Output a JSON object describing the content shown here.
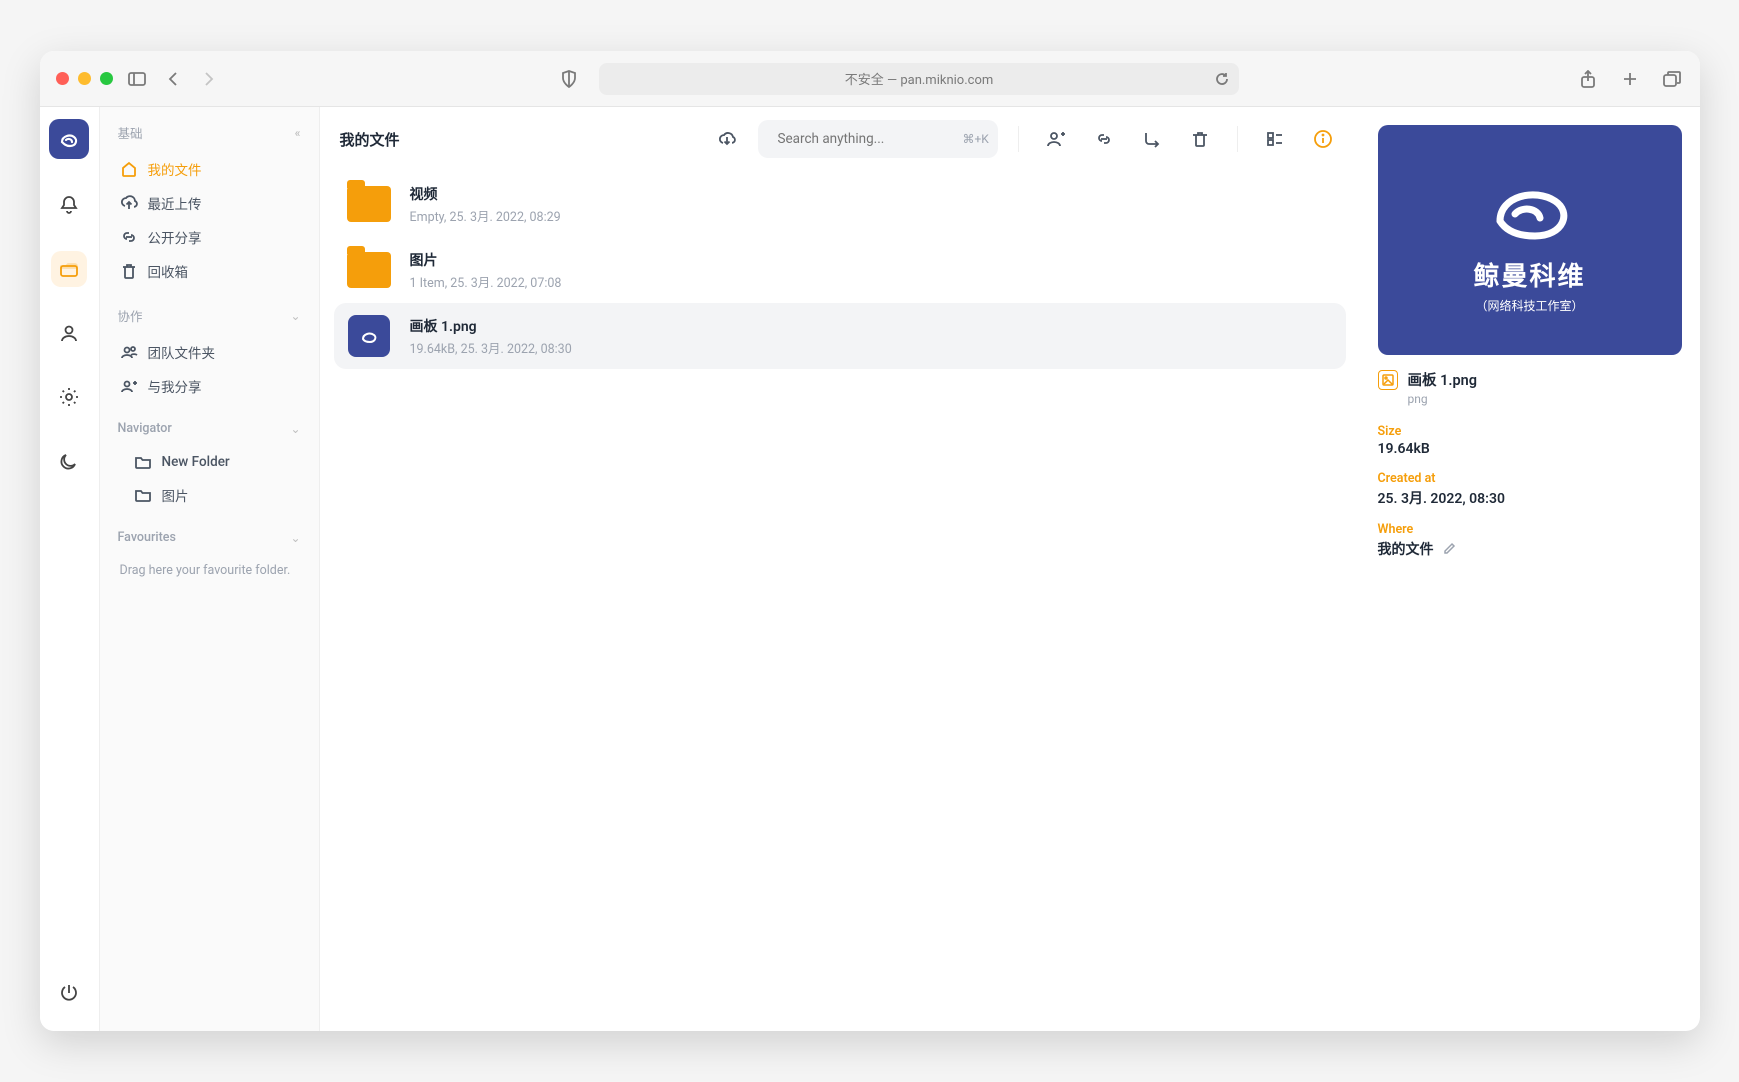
{
  "browser": {
    "address": "不安全 — pan.miknio.com"
  },
  "sidebar": {
    "section_basic": "基础",
    "my_files": "我的文件",
    "recent_upload": "最近上传",
    "public_share": "公开分享",
    "trash": "回收箱",
    "section_collab": "协作",
    "team_folders": "团队文件夹",
    "shared_with_me": "与我分享",
    "section_navigator": "Navigator",
    "nav_new_folder": "New Folder",
    "nav_pictures": "图片",
    "section_favourites": "Favourites",
    "favourites_empty": "Drag here your favourite folder."
  },
  "topbar": {
    "title": "我的文件",
    "search_placeholder": "Search anything...",
    "search_shortcut": "⌘+K"
  },
  "files": [
    {
      "name": "视频",
      "sub": "Empty, 25. 3月. 2022, 08:29",
      "type": "folder"
    },
    {
      "name": "图片",
      "sub": "1 Item, 25. 3月. 2022, 07:08",
      "type": "folder"
    },
    {
      "name": "画板 1.png",
      "sub": "19.64kB, 25. 3月. 2022, 08:30",
      "type": "image"
    }
  ],
  "details": {
    "preview_title": "鲸曼科维",
    "preview_sub": "（网络科技工作室）",
    "name": "画板 1.png",
    "ext": "png",
    "size_label": "Size",
    "size_value": "19.64kB",
    "created_label": "Created at",
    "created_value": "25. 3月. 2022, 08:30",
    "where_label": "Where",
    "where_value": "我的文件"
  }
}
